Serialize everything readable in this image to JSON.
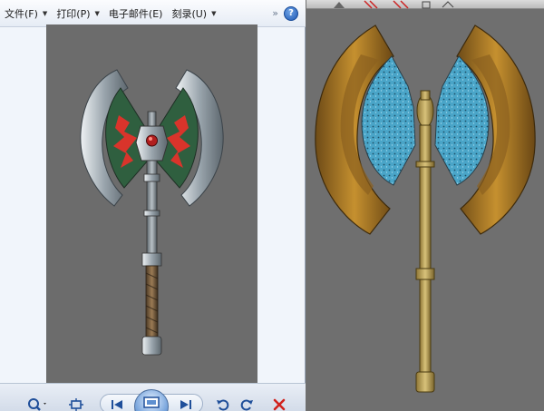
{
  "menu": {
    "items": [
      {
        "label": "文件(F)",
        "has_caret": true
      },
      {
        "label": "打印(P)",
        "has_caret": true
      },
      {
        "label": "电子邮件(E)",
        "has_caret": false
      },
      {
        "label": "刻录(U)",
        "has_caret": true
      }
    ],
    "help_label": "?"
  },
  "icons": {
    "expand": "chevron-double-right-icon",
    "help": "help-icon",
    "zoom": "magnifier-icon",
    "fit": "actual-size-icon",
    "prev": "previous-icon",
    "slideshow": "slideshow-icon",
    "next": "next-icon",
    "rotate_left": "rotate-counterclockwise-icon",
    "rotate_right": "rotate-clockwise-icon",
    "delete": "delete-icon"
  },
  "colors": {
    "left_axe_blade": "#2f5f3f",
    "left_axe_pattern": "#d9342b",
    "left_axe_edge": "#cfd6dc",
    "right_axe_blade": "#4aa5c8",
    "right_axe_rim": "#b9862c",
    "right_axe_handle": "#c8ad5d"
  }
}
